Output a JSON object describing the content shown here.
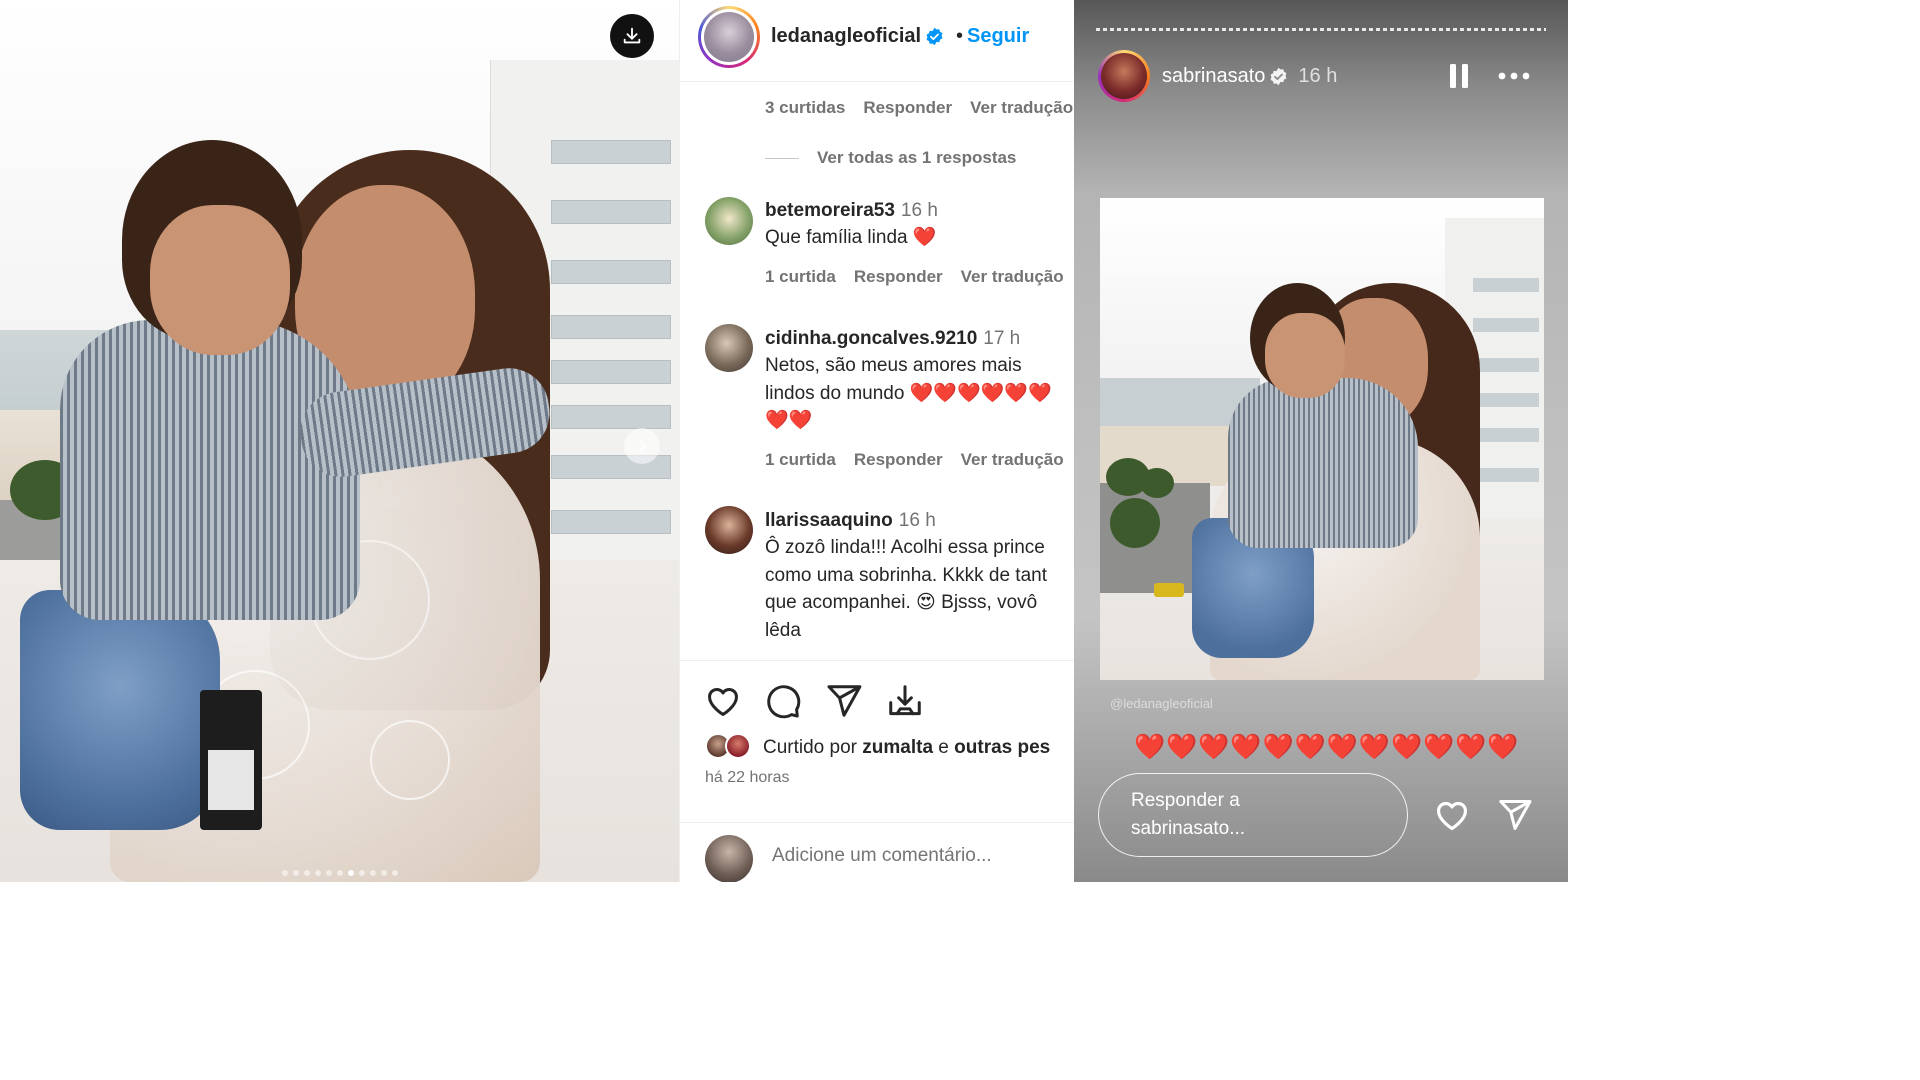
{
  "colors": {
    "link_blue": "#0095f6",
    "text_primary": "#262626",
    "text_secondary": "#737373",
    "heart_red": "#e0161d",
    "verified_blue": "#0095f6"
  },
  "photo_panel": {
    "download_icon": "download-icon",
    "next_icon": "chevron-right-icon",
    "carousel_dot_count": 11,
    "carousel_active_dot": 6
  },
  "post": {
    "author": "ledanagleoficial",
    "separator": "•",
    "follow_label": "Seguir",
    "thread": {
      "likes": "3 curtidas",
      "reply": "Responder",
      "translate": "Ver tradução",
      "view_replies": "Ver todas as 1 respostas"
    },
    "comments": [
      {
        "user": "betemoreira53",
        "time": "16 h",
        "text": "Que família linda ❤️",
        "likes": "1 curtida",
        "reply": "Responder",
        "translate": "Ver tradução"
      },
      {
        "user": "cidinha.goncalves.9210",
        "time": "17 h",
        "text": "Netos, são meus amores mais lindos do mundo ❤️❤️❤️❤️❤️❤️❤️❤️",
        "likes": "1 curtida",
        "reply": "Responder",
        "translate": "Ver tradução"
      },
      {
        "user": "llarissaaquino",
        "time": "16 h",
        "text": "Ô zozô linda!!! Acolhi essa prince como uma sobrinha. Kkkk de tant que acompanhei. 😍 Bjsss, vovô lêda"
      }
    ],
    "actions": {
      "like_icon": "heart-icon",
      "comment_icon": "comment-icon",
      "share_icon": "send-icon",
      "save_icon": "save-icon"
    },
    "liked_by": {
      "prefix": "Curtido por ",
      "user": "zumalta",
      "middle": " e ",
      "others": "outras pes"
    },
    "age": "há 22 horas",
    "add_comment_placeholder": "Adicione um comentário..."
  },
  "story": {
    "user": "sabrinasato",
    "time": "16 h",
    "pause_icon": "pause-icon",
    "more_icon": "more-icon",
    "credit": "@ledanagleoficial",
    "hearts": "❤️❤️❤️❤️❤️❤️❤️❤️❤️❤️❤️❤️",
    "reply_placeholder": "Responder a sabrinasato...",
    "like_icon": "heart-icon",
    "send_icon": "send-icon"
  }
}
